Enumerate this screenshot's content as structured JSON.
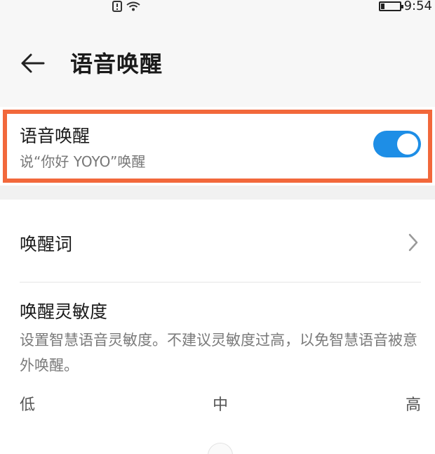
{
  "status_bar": {
    "time": "9:54",
    "sim_icon": "sim-alert-icon",
    "wifi_icon": "wifi-icon",
    "battery_icon": "battery-icon",
    "battery_level": 0.2
  },
  "header": {
    "title": "语音唤醒",
    "back_icon": "arrow-left-icon"
  },
  "wake_toggle": {
    "title": "语音唤醒",
    "subtitle": "说“你好 YOYO”唤醒",
    "enabled": true,
    "accent_color": "#1e8ee6",
    "highlight_color": "#f2683b"
  },
  "wake_word": {
    "label": "唤醒词",
    "chevron_icon": "chevron-right-icon"
  },
  "sensitivity": {
    "title": "唤醒灵敏度",
    "description": "设置智慧语音灵敏度。不建议灵敏度过高，以免智慧语音被意外唤醒。",
    "levels": [
      "低",
      "中",
      "高"
    ],
    "selected_level": "中"
  }
}
